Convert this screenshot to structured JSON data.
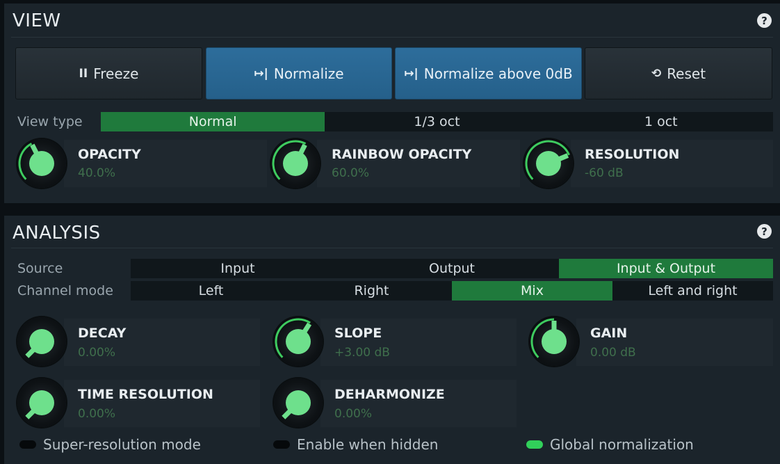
{
  "view": {
    "title": "VIEW",
    "help": "?",
    "buttons": {
      "freeze": {
        "icon": "II",
        "label": "Freeze"
      },
      "normalize": {
        "icon": "↦|",
        "label": "Normalize"
      },
      "normalize_above": {
        "icon": "↦|",
        "label": "Normalize above 0dB"
      },
      "reset": {
        "icon": "⟲",
        "label": "Reset"
      }
    },
    "view_type": {
      "label": "View type",
      "options": [
        "Normal",
        "1/3 oct",
        "1 oct"
      ],
      "selected": "Normal"
    },
    "knobs": {
      "opacity": {
        "name": "OPACITY",
        "value": "40.0%",
        "level": 0.4
      },
      "rainbow_opacity": {
        "name": "RAINBOW OPACITY",
        "value": "60.0%",
        "level": 0.6
      },
      "resolution": {
        "name": "RESOLUTION",
        "value": "-60 dB",
        "level": 0.75
      }
    }
  },
  "analysis": {
    "title": "ANALYSIS",
    "help": "?",
    "source": {
      "label": "Source",
      "options": [
        "Input",
        "Output",
        "Input & Output"
      ],
      "selected": "Input & Output"
    },
    "channel_mode": {
      "label": "Channel mode",
      "options": [
        "Left",
        "Right",
        "Mix",
        "Left and right"
      ],
      "selected": "Mix"
    },
    "knobs": {
      "decay": {
        "name": "DECAY",
        "value": "0.00%",
        "level": 0.0
      },
      "slope": {
        "name": "SLOPE",
        "value": "+3.00 dB",
        "level": 0.62
      },
      "gain": {
        "name": "GAIN",
        "value": "0.00 dB",
        "level": 0.5
      },
      "time_resolution": {
        "name": "TIME RESOLUTION",
        "value": "0.00%",
        "level": 0.0
      },
      "deharmonize": {
        "name": "DEHARMONIZE",
        "value": "0.00%",
        "level": 0.0
      }
    },
    "toggles": {
      "super_resolution": {
        "label": "Super-resolution mode",
        "on": false
      },
      "enable_hidden": {
        "label": "Enable when hidden",
        "on": false
      },
      "global_normalization": {
        "label": "Global normalization",
        "on": true
      }
    }
  },
  "colors": {
    "accent_green": "#1f7a3c",
    "knob_arc": "#3ecb5f",
    "knob_fill": "#6ee08c",
    "button_blue": "#2d6d9b"
  }
}
